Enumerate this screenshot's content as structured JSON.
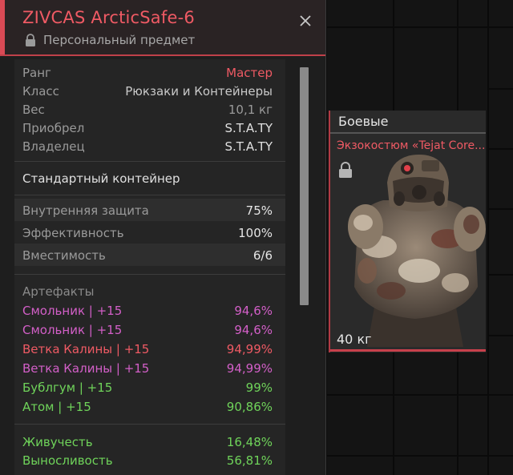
{
  "item": {
    "name": "ZIVCAS ArcticSafe-6",
    "subtitle": "Персональный предмет"
  },
  "info": [
    {
      "label": "Ранг",
      "value": "Мастер",
      "color": "#ef5a64"
    },
    {
      "label": "Класс",
      "value": "Рюкзаки и Контейнеры",
      "color": "#c9c9c9"
    },
    {
      "label": "Вес",
      "value": "10,1 кг",
      "color": "#9a9a9a"
    },
    {
      "label": "Приобрел",
      "value": "S.T.A.TY",
      "color": "#e0e0e0"
    },
    {
      "label": "Владелец",
      "value": "S.T.A.TY",
      "color": "#e0e0e0"
    }
  ],
  "container_type": "Стандартный контейнер",
  "container_stats": [
    {
      "label": "Внутренняя защита",
      "value": "75%"
    },
    {
      "label": "Эффективность",
      "value": "100%"
    },
    {
      "label": "Вместимость",
      "value": "6/6"
    }
  ],
  "artifacts_label": "Артефакты",
  "artifacts": [
    {
      "name": "Смольник | +15",
      "value": "94,6%",
      "color": "#d35fc8"
    },
    {
      "name": "Смольник | +15",
      "value": "94,6%",
      "color": "#d35fc8"
    },
    {
      "name": "Ветка Калины | +15",
      "value": "94,99%",
      "color": "#ef5a64"
    },
    {
      "name": "Ветка Калины | +15",
      "value": "94,99%",
      "color": "#d35fc8"
    },
    {
      "name": "Бублгум | +15",
      "value": "99%",
      "color": "#6fd35a"
    },
    {
      "name": "Атом | +15",
      "value": "90,86%",
      "color": "#6fd35a"
    }
  ],
  "bonuses": [
    {
      "name": "Живучесть",
      "value": "16,48%",
      "color": "#6fd35a"
    },
    {
      "name": "Выносливость",
      "value": "56,81%",
      "color": "#6fd35a"
    }
  ],
  "card": {
    "category": "Боевые",
    "name": "Экзокостюм «Tejat Core...",
    "weight": "40 кг"
  }
}
